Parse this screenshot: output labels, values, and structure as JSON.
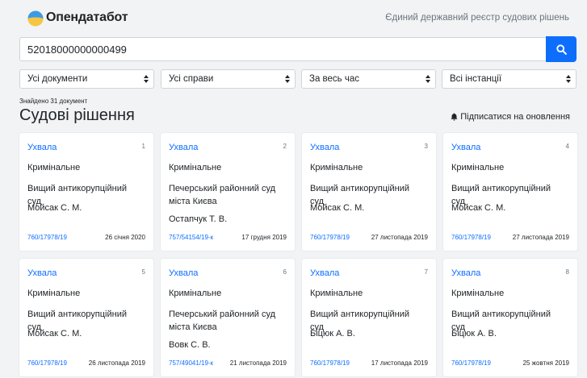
{
  "header": {
    "logo_text": "Опендатабот",
    "tagline": "Єдиний державний реєстр судових рішень"
  },
  "search": {
    "value": "52018000000000499"
  },
  "filters": [
    "Усі документи",
    "Усі справи",
    "За весь час",
    "Всі інстанції"
  ],
  "results": {
    "found_text": "Знайдено 31 документ",
    "title": "Судові рішення",
    "subscribe_label": "Підписатися на оновлення"
  },
  "cards": [
    {
      "num": "1",
      "type": "Ухвала",
      "category": "Кримінальне",
      "court": "Вищий антикорупційний суд",
      "judge": "Мойсак С. М.",
      "case_no": "760/17978/19",
      "date": "26 січня 2020"
    },
    {
      "num": "2",
      "type": "Ухвала",
      "category": "Кримінальне",
      "court": "Печерський районний суд міста Києва",
      "judge": "Остапчук Т. В.",
      "case_no": "757/54154/19-к",
      "date": "17 грудня 2019"
    },
    {
      "num": "3",
      "type": "Ухвала",
      "category": "Кримінальне",
      "court": "Вищий антикорупційний суд",
      "judge": "Мойсак С. М.",
      "case_no": "760/17978/19",
      "date": "27 листопада 2019"
    },
    {
      "num": "4",
      "type": "Ухвала",
      "category": "Кримінальне",
      "court": "Вищий антикорупційний суд",
      "judge": "Мойсак С. М.",
      "case_no": "760/17978/19",
      "date": "27 листопада 2019"
    },
    {
      "num": "5",
      "type": "Ухвала",
      "category": "Кримінальне",
      "court": "Вищий антикорупційний суд",
      "judge": "Мойсак С. М.",
      "case_no": "760/17978/19",
      "date": "26 листопада 2019"
    },
    {
      "num": "6",
      "type": "Ухвала",
      "category": "Кримінальне",
      "court": "Печерський районний суд міста Києва",
      "judge": "Вовк С. В.",
      "case_no": "757/49041/19-к",
      "date": "21 листопада 2019"
    },
    {
      "num": "7",
      "type": "Ухвала",
      "category": "Кримінальне",
      "court": "Вищий антикорупційний суд",
      "judge": "Біцюк А. В.",
      "case_no": "760/17978/19",
      "date": "17 листопада 2019"
    },
    {
      "num": "8",
      "type": "Ухвала",
      "category": "Кримінальне",
      "court": "Вищий антикорупційний суд",
      "judge": "Біцюк А. В.",
      "case_no": "760/17978/19",
      "date": "25 жовтня 2019"
    }
  ]
}
